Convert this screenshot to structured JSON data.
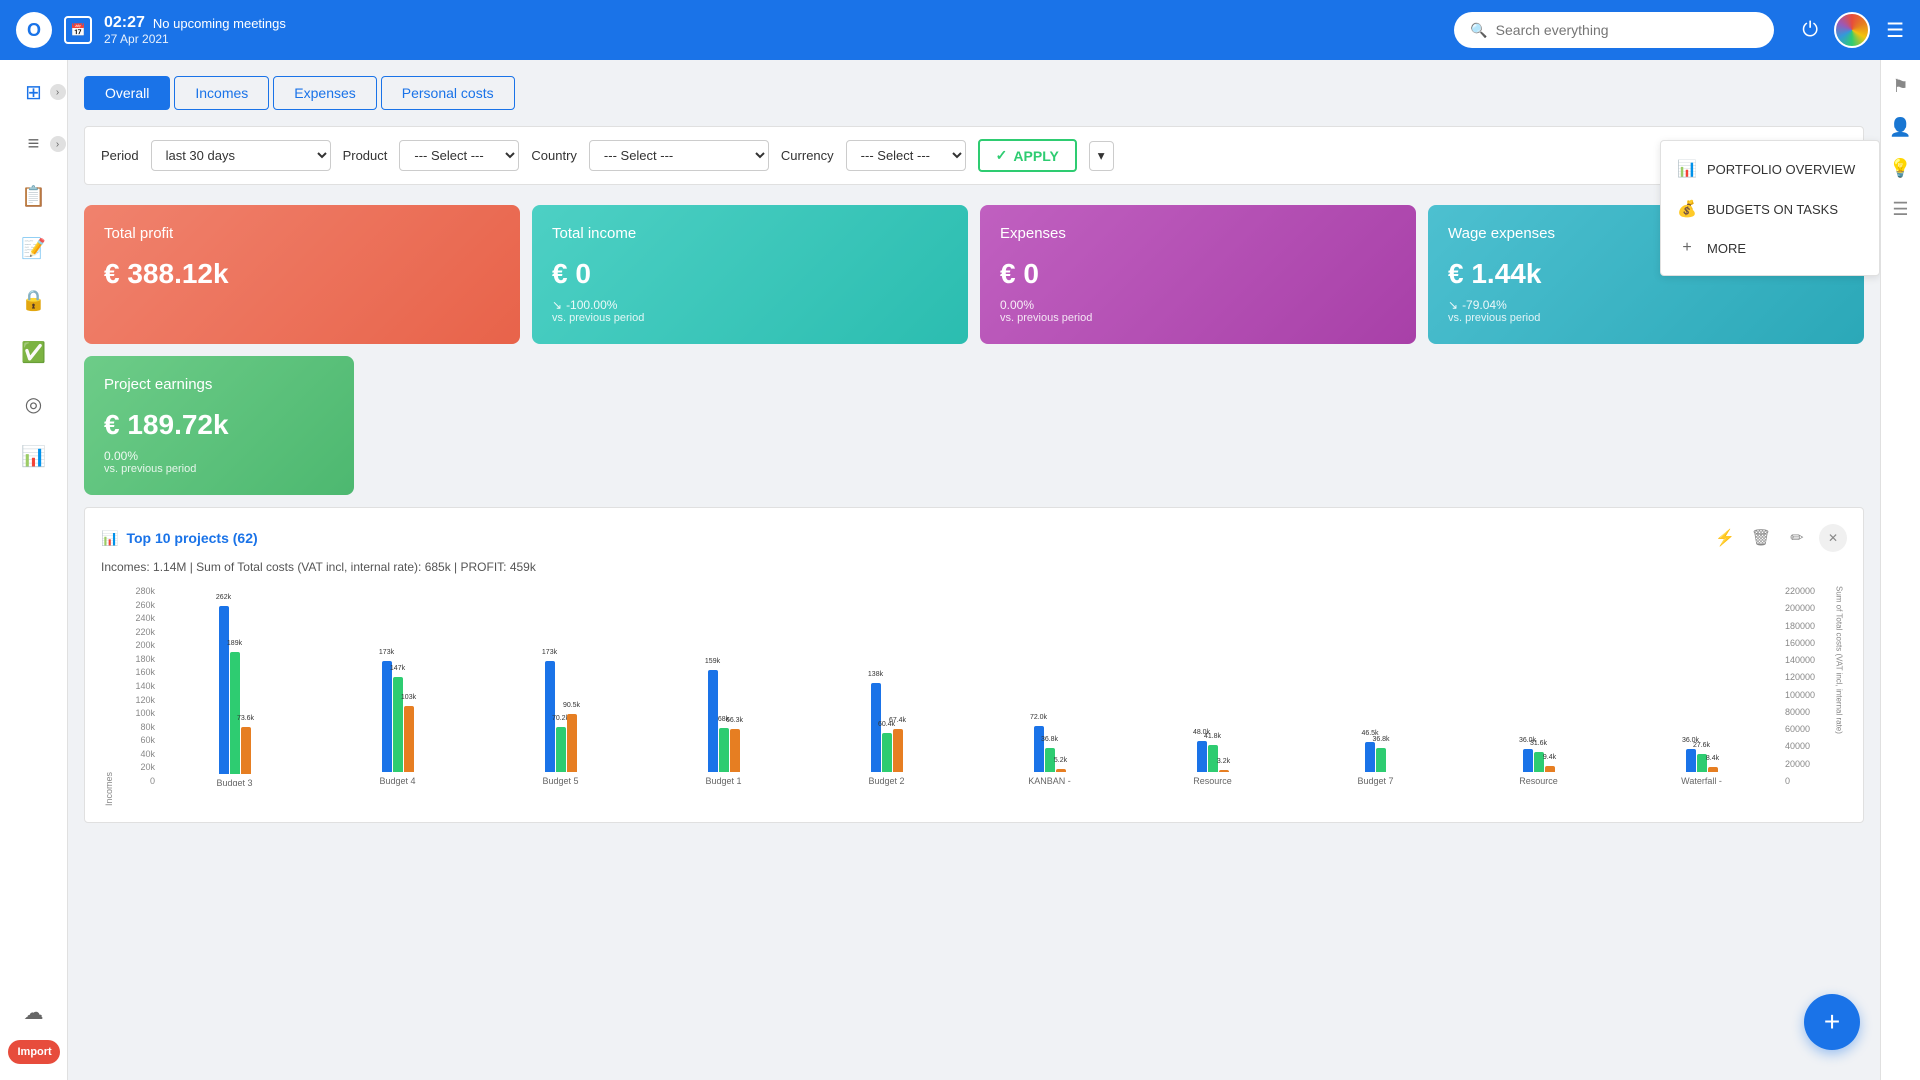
{
  "header": {
    "logo_text": "O",
    "time": "02:27",
    "no_meetings": "No upcoming meetings",
    "date": "27 Apr 2021",
    "search_placeholder": "Search everything"
  },
  "sidebar": {
    "items": [
      {
        "icon": "⊞",
        "label": "dashboard",
        "active": true
      },
      {
        "icon": "≡",
        "label": "list"
      },
      {
        "icon": "📋",
        "label": "tasks"
      },
      {
        "icon": "✓",
        "label": "checklist"
      },
      {
        "icon": "🔒",
        "label": "security"
      },
      {
        "icon": "✅",
        "label": "approvals"
      },
      {
        "icon": "◎",
        "label": "targets"
      },
      {
        "icon": "📊",
        "label": "reports"
      },
      {
        "icon": "☁",
        "label": "cloud"
      }
    ],
    "import_label": "Import"
  },
  "right_sidebar": {
    "items": [
      {
        "icon": "⚑",
        "label": "flag"
      },
      {
        "icon": "👤",
        "label": "user-search"
      },
      {
        "icon": "💡",
        "label": "lightbulb"
      },
      {
        "icon": "≡",
        "label": "checklist"
      }
    ]
  },
  "tabs": [
    {
      "label": "Overall",
      "active": true
    },
    {
      "label": "Incomes",
      "active": false
    },
    {
      "label": "Expenses",
      "active": false
    },
    {
      "label": "Personal costs",
      "active": false
    }
  ],
  "filters": {
    "period_label": "Period",
    "period_value": "last 30 days",
    "product_label": "Product",
    "product_select": "--- Select ---",
    "country_label": "Country",
    "country_select": "--- Select ---",
    "currency_label": "Currency",
    "currency_select": "--- Select ---",
    "apply_label": "APPLY"
  },
  "stats": [
    {
      "title": "Total profit",
      "value": "€ 388.12k",
      "change": "",
      "sub": "",
      "card_class": "card-salmon"
    },
    {
      "title": "Total income",
      "value": "€ 0",
      "change": "-100.00%",
      "sub": "vs. previous period",
      "card_class": "card-teal"
    },
    {
      "title": "Expenses",
      "value": "€ 0",
      "change": "0.00%",
      "sub": "vs. previous period",
      "card_class": "card-purple"
    },
    {
      "title": "Wage expenses",
      "value": "€ 1.44k",
      "change": "-79.04%",
      "sub": "vs. previous period",
      "card_class": "card-blue"
    }
  ],
  "project_earnings": {
    "title": "Project earnings",
    "value": "€ 189.72k",
    "change": "0.00%",
    "sub": "vs. previous period"
  },
  "dropdown_panel": {
    "items": [
      {
        "icon": "📊",
        "label": "PORTFOLIO OVERVIEW"
      },
      {
        "icon": "💰",
        "label": "BUDGETS ON TASKS"
      },
      {
        "icon": "+",
        "label": "MORE"
      }
    ]
  },
  "chart": {
    "title": "Top 10 projects (62)",
    "subtitle": "Incomes: 1.14M | Sum of Total costs (VAT incl, internal rate): 685k | PROFIT: 459k",
    "y_axis_left": [
      "280k",
      "260k",
      "240k",
      "220k",
      "200k",
      "180k",
      "160k",
      "140k",
      "120k",
      "100k",
      "80k",
      "60k",
      "40k",
      "20k",
      "0"
    ],
    "y_axis_right": [
      "220000",
      "200000",
      "180000",
      "160000",
      "140000",
      "120000",
      "100000",
      "80000",
      "60000",
      "40000",
      "20000",
      "0"
    ],
    "bars": [
      {
        "name": "Budget 3",
        "blue": 262,
        "green": 189,
        "orange": 73.6,
        "blue_label": "262k",
        "green_label": "189k",
        "orange_label": "73.6k"
      },
      {
        "name": "Budget 4",
        "blue": 173,
        "green": 147,
        "orange": 103,
        "blue_label": "173k",
        "green_label": "147k",
        "orange_label": "103k"
      },
      {
        "name": "Budget 5",
        "blue": 173,
        "green": 70.2,
        "orange": 90.5,
        "blue_label": "173k",
        "green_label": "70.2k",
        "orange_label": "90.5k"
      },
      {
        "name": "Budget 1",
        "blue": 159,
        "green": 68,
        "orange": 66.3,
        "blue_label": "159k",
        "green_label": "68k",
        "orange_label": "66.3k"
      },
      {
        "name": "Budget 2",
        "blue": 138,
        "green": 60.4,
        "orange": 67.4,
        "blue_label": "138k",
        "green_label": "60.4k",
        "orange_label": "67.4k"
      },
      {
        "name": "KANBAN -",
        "blue": 72,
        "green": 36.8,
        "orange": 5.2,
        "blue_label": "72.0k",
        "green_label": "36.8k",
        "orange_label": "5.2k"
      },
      {
        "name": "Resource",
        "blue": 48,
        "green": 41.8,
        "orange": 3.2,
        "blue_label": "48.0k",
        "green_label": "41.8k",
        "orange_label": "3.2k"
      },
      {
        "name": "Budget 7",
        "blue": 46.5,
        "green": 36.8,
        "orange": 0,
        "blue_label": "46.5k",
        "green_label": "36.8k",
        "orange_label": ""
      },
      {
        "name": "Resource",
        "blue": 36,
        "green": 31.6,
        "orange": 9.4,
        "blue_label": "36.0k",
        "green_label": "31.6k",
        "orange_label": "9.4k"
      },
      {
        "name": "Waterfall -",
        "blue": 36,
        "green": 27.6,
        "orange": 8.4,
        "blue_label": "36.0k",
        "green_label": "27.6k",
        "orange_label": "8.4k"
      }
    ]
  },
  "fab": {
    "icon": "+"
  }
}
